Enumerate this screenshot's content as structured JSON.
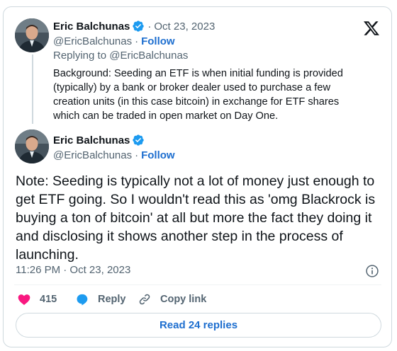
{
  "brand": {
    "logo_icon": "x-logo-icon",
    "accent": "#1d9bf0",
    "link_color": "#1d6ecf",
    "like_color": "#f91880"
  },
  "parent_tweet": {
    "author_name": "Eric Balchunas",
    "date": "Oct 23, 2023",
    "handle": "@EricBalchunas",
    "follow_label": "Follow",
    "replying_to": "Replying to @EricBalchunas",
    "text": "Background: Seeding an ETF is when initial funding is provided (typically) by a bank or broker dealer used to purchase a few creation units (in this case bitcoin) in exchange for ETF shares which can be traded in open market on Day One."
  },
  "main_tweet": {
    "author_name": "Eric Balchunas",
    "handle": "@EricBalchunas",
    "follow_label": "Follow",
    "text": "Note: Seeding is typically not a lot of money just enough to get ETF going. So I wouldn't read this as 'omg Blackrock is buying a ton of bitcoin' at all but more the fact they doing it and disclosing it shows another step in the process of launching.",
    "timestamp": "11:26 PM · Oct 23, 2023"
  },
  "actions": {
    "like_count": "415",
    "reply_label": "Reply",
    "copy_link_label": "Copy link"
  },
  "read_replies_label": "Read 24 replies"
}
